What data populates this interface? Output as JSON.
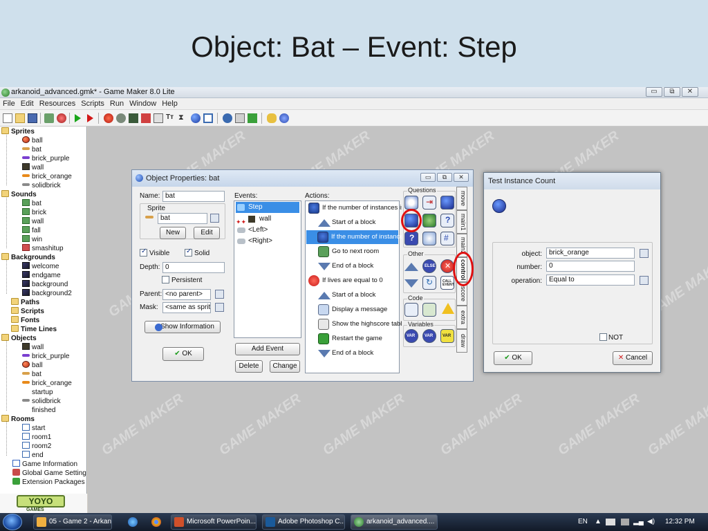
{
  "slide": {
    "title": "Object: Bat – Event: Step"
  },
  "app": {
    "title": "arkanoid_advanced.gmk* - Game Maker 8.0 Lite",
    "window_buttons": [
      "▭",
      "⧉",
      "✕"
    ],
    "menu": [
      "File",
      "Edit",
      "Resources",
      "Scripts",
      "Run",
      "Window",
      "Help"
    ]
  },
  "tree": {
    "sprites": {
      "label": "Sprites",
      "items": [
        "ball",
        "bat",
        "brick_purple",
        "wall",
        "brick_orange",
        "solidbrick"
      ]
    },
    "sounds": {
      "label": "Sounds",
      "items": [
        "bat",
        "brick",
        "wall",
        "fall",
        "win",
        "smashitup"
      ]
    },
    "backgrounds": {
      "label": "Backgrounds",
      "items": [
        "welcome",
        "endgame",
        "background",
        "background2"
      ]
    },
    "paths": "Paths",
    "scripts": "Scripts",
    "fonts": "Fonts",
    "timelines": "Time Lines",
    "objects": {
      "label": "Objects",
      "items": [
        "wall",
        "brick_purple",
        "ball",
        "bat",
        "brick_orange",
        "startup",
        "solidbrick",
        "finished"
      ]
    },
    "rooms": {
      "label": "Rooms",
      "items": [
        "start",
        "room1",
        "room2",
        "end"
      ]
    },
    "game_information": "Game Information",
    "global_game_settings": "Global Game Settings",
    "extension_packages": "Extension Packages"
  },
  "logo": {
    "text": "YOYO",
    "sub": "GAMES"
  },
  "watermark": "GAME MAKER",
  "object_props": {
    "title": "Object Properties: bat",
    "name_label": "Name:",
    "name_value": "bat",
    "sprite_label": "Sprite",
    "sprite_value": "bat",
    "new_label": "New",
    "edit_label": "Edit",
    "visible_label": "Visible",
    "solid_label": "Solid",
    "depth_label": "Depth:",
    "depth_value": "0",
    "persistent_label": "Persistent",
    "parent_label": "Parent:",
    "parent_value": "<no parent>",
    "mask_label": "Mask:",
    "mask_value": "<same as sprite>",
    "show_info_label": "Show Information",
    "ok_label": "OK",
    "events_label": "Events:",
    "events": [
      "Step",
      "wall",
      "<Left>",
      "<Right>"
    ],
    "add_event_label": "Add Event",
    "delete_label": "Delete",
    "change_label": "Change",
    "actions_label": "Actions:",
    "actions": [
      "If the number of instances is",
      "Start of a block",
      "If the number of instance",
      "Go to next room",
      "End of a block",
      "If lives are equal to 0",
      "Start of a block",
      "Display a message",
      "Show the highscore table",
      "Restart the game",
      "End of a block"
    ],
    "palette": {
      "questions": "Questions",
      "other": "Other",
      "code": "Code",
      "variables": "Variables",
      "else_label": "ELSE",
      "call_label": "CALL EVENT",
      "var_label": "VAR"
    },
    "tabs": [
      "move",
      "main1",
      "main2",
      "control",
      "score",
      "extra",
      "draw"
    ]
  },
  "test_instance": {
    "title": "Test Instance Count",
    "object_label": "object:",
    "object_value": "brick_orange",
    "number_label": "number:",
    "number_value": "0",
    "operation_label": "operation:",
    "operation_value": "Equal to",
    "not_label": "NOT",
    "ok_label": "OK",
    "cancel_label": "Cancel"
  },
  "taskbar": {
    "buttons": [
      "05 - Game 2 - Arkan...",
      "Microsoft PowerPoin...",
      "Adobe Photoshop C...",
      "arkanoid_advanced...."
    ],
    "lang": "EN",
    "time": "12:32 PM"
  },
  "colors": {
    "accent": "#3a8ee6",
    "highlight_ring": "#e01010",
    "header_bg": "#cfe0ec"
  }
}
